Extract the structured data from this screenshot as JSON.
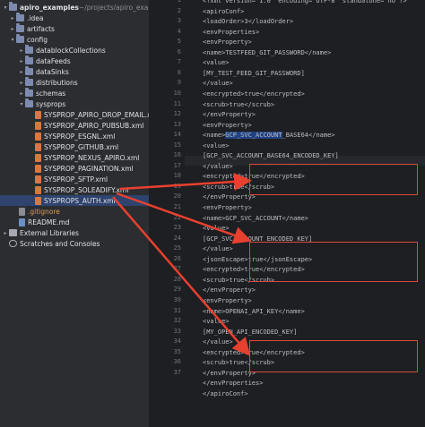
{
  "tree": {
    "rows": [
      {
        "label": "apiro_examples",
        "suffix": " ~/projects/apiro_examples"
      },
      {
        "label": ".idea"
      },
      {
        "label": "artifacts"
      },
      {
        "label": "config"
      },
      {
        "label": "datablockCollections"
      },
      {
        "label": "dataFeeds"
      },
      {
        "label": "dataSinks"
      },
      {
        "label": "distributions"
      },
      {
        "label": "schemas"
      },
      {
        "label": "sysprops"
      },
      {
        "label": "SYSPROP_APIRO_DROP_EMAIL.xml"
      },
      {
        "label": "SYSPROP_APIRO_PUBSUB.xml"
      },
      {
        "label": "SYSPROP_ESGNL.xml"
      },
      {
        "label": "SYSPROP_GITHUB.xml"
      },
      {
        "label": "SYSPROP_NEXUS_APIRO.xml"
      },
      {
        "label": "SYSPROP_PAGINATION.xml"
      },
      {
        "label": "SYSPROP_SFTP.xml"
      },
      {
        "label": "SYSPROP_SOLEADIFY.xml"
      },
      {
        "label": "SYSPROPS_AUTH.xml"
      },
      {
        "label": ".gitignore"
      },
      {
        "label": "README.md"
      },
      {
        "label": "External Libraries"
      },
      {
        "label": "Scratches and Consoles"
      }
    ]
  },
  "editor": {
    "line_numbers": [
      "1",
      "2",
      "3",
      "4",
      "5",
      "6",
      "7",
      "8",
      "9",
      "10",
      "11",
      "12",
      "13",
      "14",
      "15",
      "16",
      "17",
      "18",
      "19",
      "20",
      "21",
      "22",
      "23",
      "24",
      "25",
      "26",
      "27",
      "28",
      "29",
      "30",
      "31",
      "32",
      "33",
      "34",
      "35",
      "36",
      "37"
    ],
    "lines": [
      "<?xml version=\"1.0\" encoding=\"UTF-8\" standalone=\"no\"?>",
      "<apiroConf>",
      "    <loadOrder>3</loadOrder>",
      "    <envProperties>",
      "        <envProperty>",
      "            <name>TESTFEED_GIT_PASSWORD</name>",
      "            <value>",
      "                [MY_TEST_FEED_GIT_PASSWORD]",
      "            </value>",
      "            <encrypted>true</encrypted>",
      "            <scrub>true</scrub>",
      "        </envProperty>",
      "        <envProperty>",
      "            <name>GCP_SVC_ACCOUNT_BASE64</name>",
      "            <value>",
      "                [GCP_SVC_ACCOUNT_BASE64_ENCODED_KEY]",
      "            </value>",
      "            <encrypted>true</encrypted>",
      "            <scrub>true</scrub>",
      "        </envProperty>",
      "        <envProperty>",
      "            <name>GCP_SVC_ACCOUNT</name>",
      "            <value>",
      "                [GCP_SVC_ACCOUNT_ENCODED_KEY]",
      "            </value>",
      "            <jsonEscape>true</jsonEscape>",
      "            <encrypted>true</encrypted>",
      "            <scrub>true</scrub>",
      "        </envProperty>",
      "        <envProperty>",
      "            <name>OPENAI_API_KEY</name>",
      "            <value>",
      "                [MY_OPEN_API_ENCODED_KEY]",
      "            </value>",
      "            <encrypted>true</encrypted>",
      "            <scrub>true</scrub>",
      "        </envProperty>",
      "    </envProperties>",
      "</apiroConf>"
    ]
  },
  "colors": {
    "arrow": "#e8402f",
    "highlight_box": "#d94a3d",
    "selection": "#2e436e",
    "tag": "#d5b778"
  },
  "icons": [
    "chevron-down-icon",
    "chevron-right-icon",
    "folder-icon",
    "xml-file-icon",
    "markdown-file-icon",
    "git-file-icon",
    "library-icon",
    "scratches-icon"
  ]
}
